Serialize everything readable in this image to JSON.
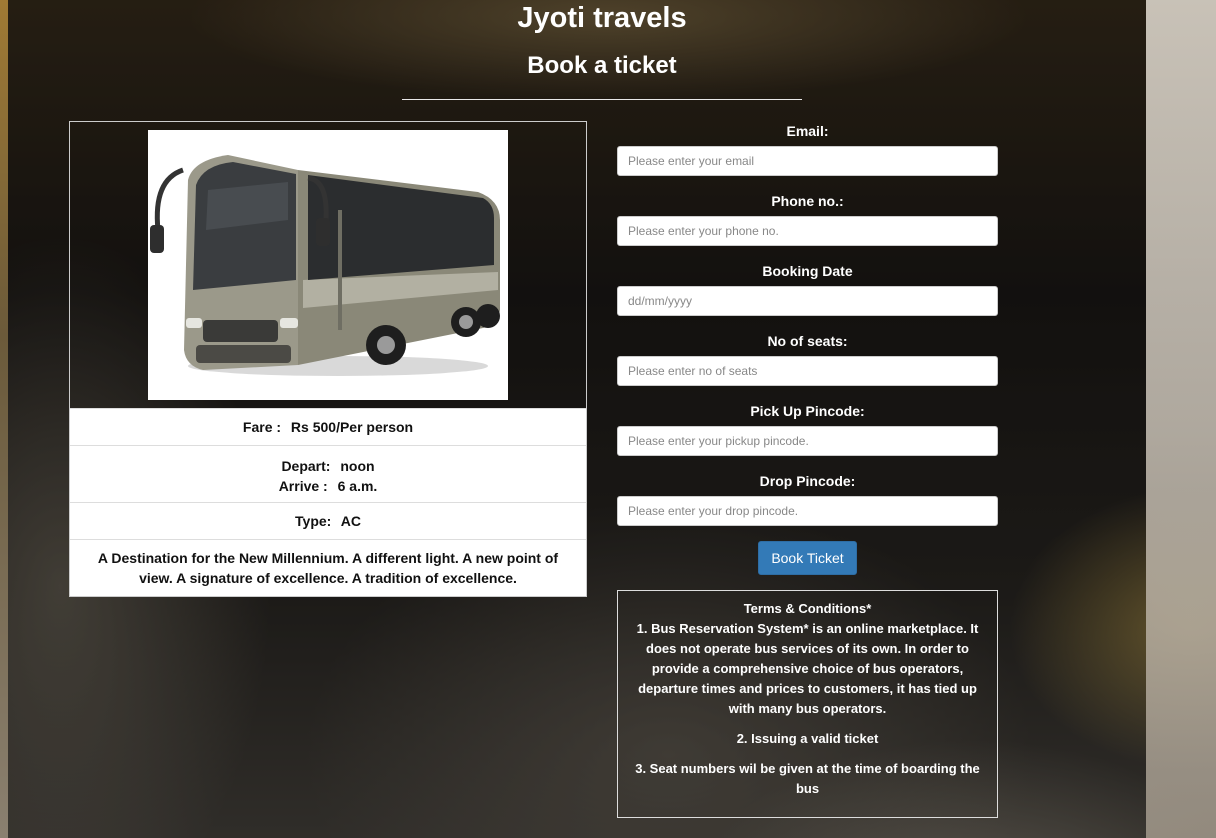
{
  "site": {
    "title": "Jyoti travels",
    "subtitle": "Book a ticket"
  },
  "bus": {
    "fare_label": "Fare :",
    "fare_value": "Rs 500/Per person",
    "depart_label": "Depart:",
    "depart_value": "noon",
    "arrive_label": "Arrive :",
    "arrive_value": "6 a.m.",
    "type_label": "Type:",
    "type_value": "AC",
    "description": "A Destination for the New Millennium. A different light. A new point of view. A signature of excellence. A tradition of excellence."
  },
  "form": {
    "email_label": "Email:",
    "email_placeholder": "Please enter your email",
    "phone_label": "Phone no.:",
    "phone_placeholder": "Please enter your phone no.",
    "date_label": "Booking Date",
    "date_placeholder": "dd/mm/yyyy",
    "seats_label": "No of seats:",
    "seats_placeholder": "Please enter no of seats",
    "pickup_label": "Pick Up Pincode:",
    "pickup_placeholder": "Please enter your pickup pincode.",
    "drop_label": "Drop Pincode:",
    "drop_placeholder": "Please enter your drop pincode.",
    "submit_label": "Book Ticket"
  },
  "terms": {
    "heading": "Terms & Conditions*",
    "item1": "1. Bus Reservation System* is an online marketplace. It does not operate bus services of its own. In order to provide a comprehensive choice of bus operators, departure times and prices to customers, it has tied up with many bus operators.",
    "item2": "2. Issuing a valid ticket",
    "item3": "3. Seat numbers wil be given at the time of boarding the bus"
  },
  "colors": {
    "button": "#337ab7",
    "card_bg": "#ffffff"
  }
}
